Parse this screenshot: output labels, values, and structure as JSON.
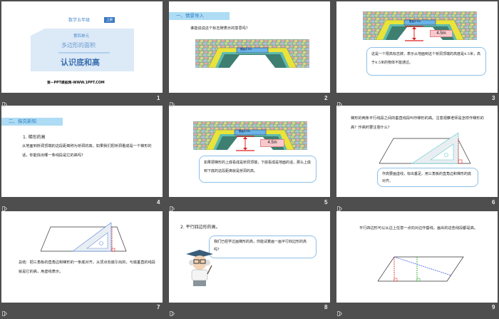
{
  "colors": {
    "accent": "#2f7fc0",
    "header_bg": "#aedcf4",
    "panel": "#dce9f7",
    "bubble_border": "#8cc0e8",
    "red": "#e02020"
  },
  "slides": [
    {
      "number": "1",
      "grade": "数学五年级",
      "badge": "上册",
      "unit": "第四单元",
      "chapter": "多边形的面积",
      "title": "认识底和高",
      "footer": "第一PPT模板网-WWW.1PPT.COM"
    },
    {
      "number": "2",
      "header": "一、情景导入",
      "question": "谁能说说这个标志牌表示的意思吗？",
      "sign": "限高4.5m"
    },
    {
      "number": "3",
      "sign": "限高4.5m",
      "height_label": "4.5m",
      "bubble": "这是一个限高标志牌，表示从地面到这个桥洞顶端的高度是4.5米，高于4.5米的物体不能通过。"
    },
    {
      "number": "4",
      "header": "二、探究新知",
      "subtitle": "1. 梯形的高",
      "paragraph": "从地面到桥洞顶端的这段距离称为桥洞的高。如果我们把桥洞看成是一个梯形的话，你能找出哪一条线段是它的高吗？"
    },
    {
      "number": "5",
      "sign": "限高4.5m",
      "height_label": "4.5m",
      "bubble": "如果把梯形的上底看成是桥洞顶端，下底看成是地面的话，那么上底到下底的这段距离就是桥洞的高。"
    },
    {
      "number": "6",
      "paragraph": "梯形的两条平行线段之间的垂直线段叫作梯形的高。注意观察老师是怎样作梯形的高？作高时要注意什么？",
      "bubble": "作高要画虚线，标出垂足。用三角板的直角边和梯形的底对齐。"
    },
    {
      "number": "7",
      "paragraph": "总结：把三角板的直角边和梯形的一条底对齐，从顶点向底引出的，与底垂直的线段就是它的高，用虚线表示。"
    },
    {
      "number": "8",
      "subtitle": "2. 平行四边形的高。",
      "bubble": "我们已经学过画梯形的高，你能试着画一画平行四边形的高吗？"
    },
    {
      "number": "9",
      "paragraph": "平行四边形可以从边上任意一点向对边作垂线，画出的这些线段都是高。"
    }
  ]
}
